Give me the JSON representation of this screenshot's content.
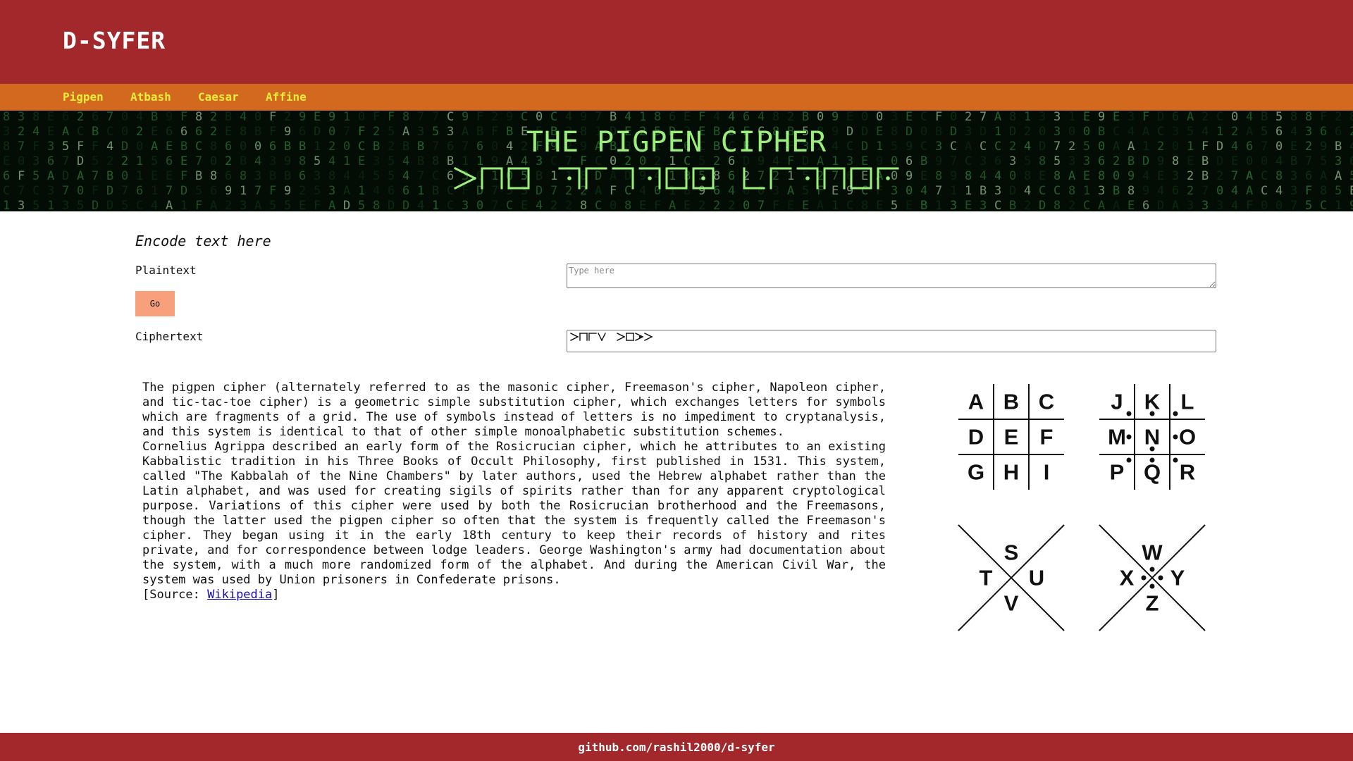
{
  "header": {
    "logo": "D-SYFER"
  },
  "nav": {
    "items": [
      "Pigpen",
      "Atbash",
      "Caesar",
      "Affine"
    ]
  },
  "banner": {
    "title": "THE PIGPEN CIPHER",
    "cipher_title_of": "THE PIGPEN CIPHER"
  },
  "form": {
    "section_title": "Encode text here",
    "plaintext_label": "Plaintext",
    "plaintext_placeholder": "Type here",
    "plaintext_value": "",
    "go_label": "Go",
    "ciphertext_label": "Ciphertext",
    "ciphertext_of": "THIS TEXT"
  },
  "description": {
    "paragraph1": "The pigpen cipher (alternately referred to as the masonic cipher, Freemason's cipher, Napoleon cipher, and tic-tac-toe cipher) is a geometric simple substitution cipher, which exchanges letters for symbols which are fragments of a grid. The use of symbols instead of letters is no impediment to cryptanalysis, and this system is identical to that of other simple monoalphabetic substitution schemes.",
    "paragraph2": "Cornelius Agrippa described an early form of the Rosicrucian cipher, which he attributes to an existing Kabbalistic tradition in his Three Books of Occult Philosophy, first published in 1531. This system, called \"The Kabbalah of the Nine Chambers\" by later authors, used the Hebrew alphabet rather than the Latin alphabet, and was used for creating sigils of spirits rather than for any apparent cryptological purpose. Variations of this cipher were used by both the Rosicrucian brotherhood and the Freemasons, though the latter used the pigpen cipher so often that the system is frequently called the Freemason's cipher. They began using it in the early 18th century to keep their records of history and rites private, and for correspondence between lodge leaders. George Washington's army had documentation about the system, with a much more randomized form of the alphabet. And during the American Civil War, the system was used by Union prisoners in Confederate prisons.",
    "source_prefix": "[Source: ",
    "source_link": "Wikipedia",
    "source_suffix": "]"
  },
  "key": {
    "grid1": [
      "A",
      "B",
      "C",
      "D",
      "E",
      "F",
      "G",
      "H",
      "I"
    ],
    "grid2": [
      "J",
      "K",
      "L",
      "M",
      "N",
      "O",
      "P",
      "Q",
      "R"
    ],
    "x1": [
      "S",
      "T",
      "U",
      "V"
    ],
    "x2": [
      "W",
      "X",
      "Y",
      "Z"
    ]
  },
  "footer": {
    "text": "github.com/rashil2000/d-syfer"
  },
  "colors": {
    "header": "#a3282b",
    "nav": "#d2691e",
    "nav_text": "#e6ee3a",
    "banner_green": "#9bf07a",
    "go_button": "#f8a07b"
  }
}
